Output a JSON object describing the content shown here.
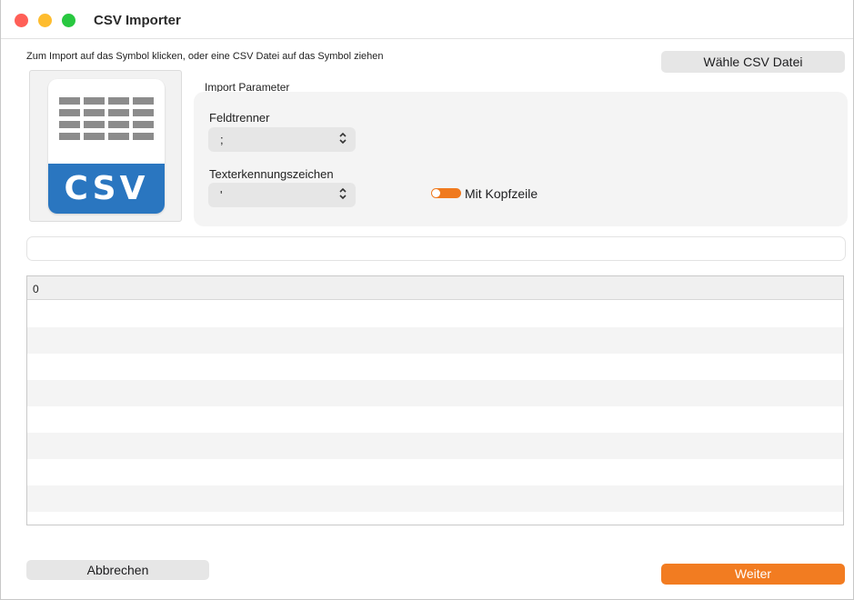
{
  "window": {
    "title": "CSV Importer"
  },
  "instruction": "Zum Import auf das Symbol klicken, oder eine CSV Datei auf das Symbol ziehen",
  "choose_button": "Wähle CSV Datei",
  "csv_icon": {
    "text": "CSV",
    "band_color": "#2a76c0"
  },
  "params": {
    "title": "Import Parameter",
    "delimiter": {
      "label": "Feldtrenner",
      "value": ";"
    },
    "text_qualifier": {
      "label": "Texterkennungszeichen",
      "value": "'"
    },
    "header_toggle": {
      "label": "Mit Kopfzeile",
      "on": true,
      "color": "#f07a1f"
    }
  },
  "file_path": {
    "value": ""
  },
  "table": {
    "columns": [
      "0"
    ],
    "rows": []
  },
  "footer": {
    "cancel_label": "Abbrechen",
    "next_label": "Weiter",
    "next_color": "#f27c21"
  }
}
